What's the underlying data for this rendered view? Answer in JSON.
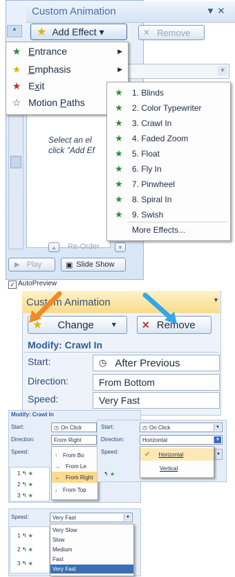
{
  "panel1": {
    "title": "Custom Animation",
    "title_controls": "▼ ✕",
    "add_effect_label": "Add Effect ▾",
    "remove_label": "Remove",
    "effect_menu": [
      {
        "icon": "entrance-star-icon",
        "glyph": "★",
        "color": "#2f8b3a",
        "label": "Entrance"
      },
      {
        "icon": "emphasis-star-icon",
        "glyph": "★",
        "color": "#d9b800",
        "label": "Emphasis"
      },
      {
        "icon": "exit-star-icon",
        "glyph": "★",
        "color": "#c8321e",
        "label": "Exit"
      },
      {
        "icon": "motion-path-star-icon",
        "glyph": "☆",
        "color": "#444444",
        "label": "Motion Paths"
      }
    ],
    "entrance_submenu": [
      "1. Blinds",
      "2. Color Typewriter",
      "3. Crawl In",
      "4. Faded Zoom",
      "5. Float",
      "6. Fly In",
      "7. Pinwheel",
      "8. Spiral In",
      "9. Swish",
      "More Effects..."
    ],
    "hint_text": "Select an element of the slide, then click \"Add Effect\" to add animation.",
    "hint_visible_line1": "Select an el",
    "hint_visible_line2": "click \"Add Ef",
    "reorder_label": "Re-Order",
    "play_label": "Play",
    "slideshow_label": "Slide Show",
    "autopreview_label": "AutoPreview",
    "autopreview_checked": true
  },
  "panel2": {
    "title": "Custom Animation",
    "change_label": "Change",
    "remove_label": "Remove",
    "modify_heading": "Modify: Crawl In",
    "start_label": "Start:",
    "start_value": "After Previous",
    "direction_label": "Direction:",
    "direction_value": "From Bottom",
    "speed_label": "Speed:",
    "speed_value": "Very Fast",
    "arrow_colors": {
      "orange": "#f08a24",
      "blue": "#35a7e8"
    }
  },
  "panel3": {
    "heading": "Modify: Crawl In",
    "start_label": "Start:",
    "start_value": "On Click",
    "direction_label": "Direction:",
    "direction_value": "From Right",
    "speed_label": "Speed:",
    "direction_options": [
      "From Bo",
      "From Le",
      "From Right",
      "From Top"
    ],
    "rows": [
      "1",
      "2",
      "3"
    ],
    "right_start_label": "Start:",
    "right_start_value": "On Click",
    "right_direction_label": "Direction:",
    "right_direction_value": "Horizontal",
    "right_speed_label": "Speed:",
    "right_options": [
      "Horizontal",
      "Vertical"
    ]
  },
  "panel4": {
    "speed_label": "Speed:",
    "speed_value": "Very Fast",
    "speed_options": [
      "Very Slow",
      "Slow",
      "Medium",
      "Fast",
      "Very Fast"
    ],
    "rows": [
      "1",
      "2",
      "3"
    ]
  }
}
